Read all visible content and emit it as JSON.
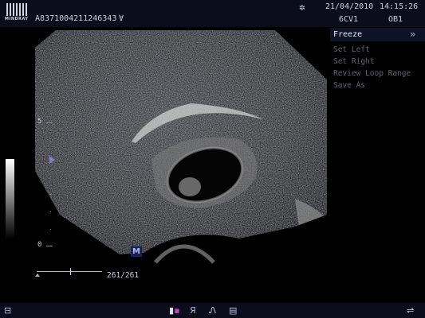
{
  "header": {
    "logo_text": "MINDRAY",
    "patient_id": "A8371004211246343",
    "patient_flag": "∀",
    "freeze_indicator_icon": "snowflake-icon",
    "date": "21/04/2010",
    "time": "14:15:26",
    "probe": "6CV1",
    "exam": "OB1"
  },
  "menu": {
    "title": "Freeze",
    "items": [
      "Set Left",
      "Set Right",
      "Review Loop Range",
      "Save As"
    ]
  },
  "scale": {
    "depth_5": "5",
    "depth_0": "0"
  },
  "image": {
    "m_mark": "M"
  },
  "cine": {
    "frames": "261/261"
  },
  "bottom_icons": {
    "left": "panel-icon",
    "icons": [
      "bodymark-icon",
      "R-icon",
      "L-icon",
      "report-icon",
      "usb-icon"
    ],
    "r_label": "Я",
    "l_label": "Ꮑ"
  },
  "colors": {
    "bar_bg": "#0b0d1c",
    "accent": "#7d86c2",
    "menu_active": "#e6e8f0",
    "menu_inactive": "#5f6474"
  }
}
